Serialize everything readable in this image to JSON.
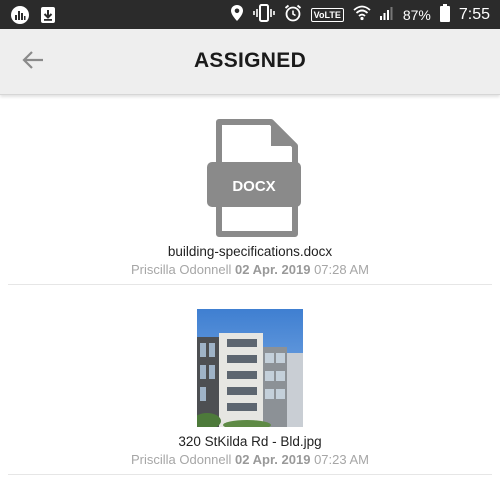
{
  "status_bar": {
    "battery": "87%",
    "time": "7:55",
    "network_badge": "VoLTE",
    "icons": [
      "equalizer-icon",
      "download-icon",
      "location-icon",
      "vibrate-icon",
      "alarm-icon",
      "wifi-icon",
      "signal-icon",
      "battery-icon"
    ]
  },
  "app_bar": {
    "title": "ASSIGNED",
    "back_icon": "arrow-left-icon"
  },
  "attachments": [
    {
      "file_type_label": "DOCX",
      "name": "building-specifications.docx",
      "author": "Priscilla Odonnell",
      "date": "02 Apr. 2019",
      "time": "07:28 AM"
    },
    {
      "name": "320 StKilda Rd - Bld.jpg",
      "author": "Priscilla Odonnell",
      "date": "02 Apr. 2019",
      "time": "07:23 AM"
    }
  ],
  "colors": {
    "status_bar": "#2b2b2b",
    "app_bar": "#eeeeee",
    "doc_icon": "#8a8a8a",
    "meta_text": "#a6a6a6"
  }
}
